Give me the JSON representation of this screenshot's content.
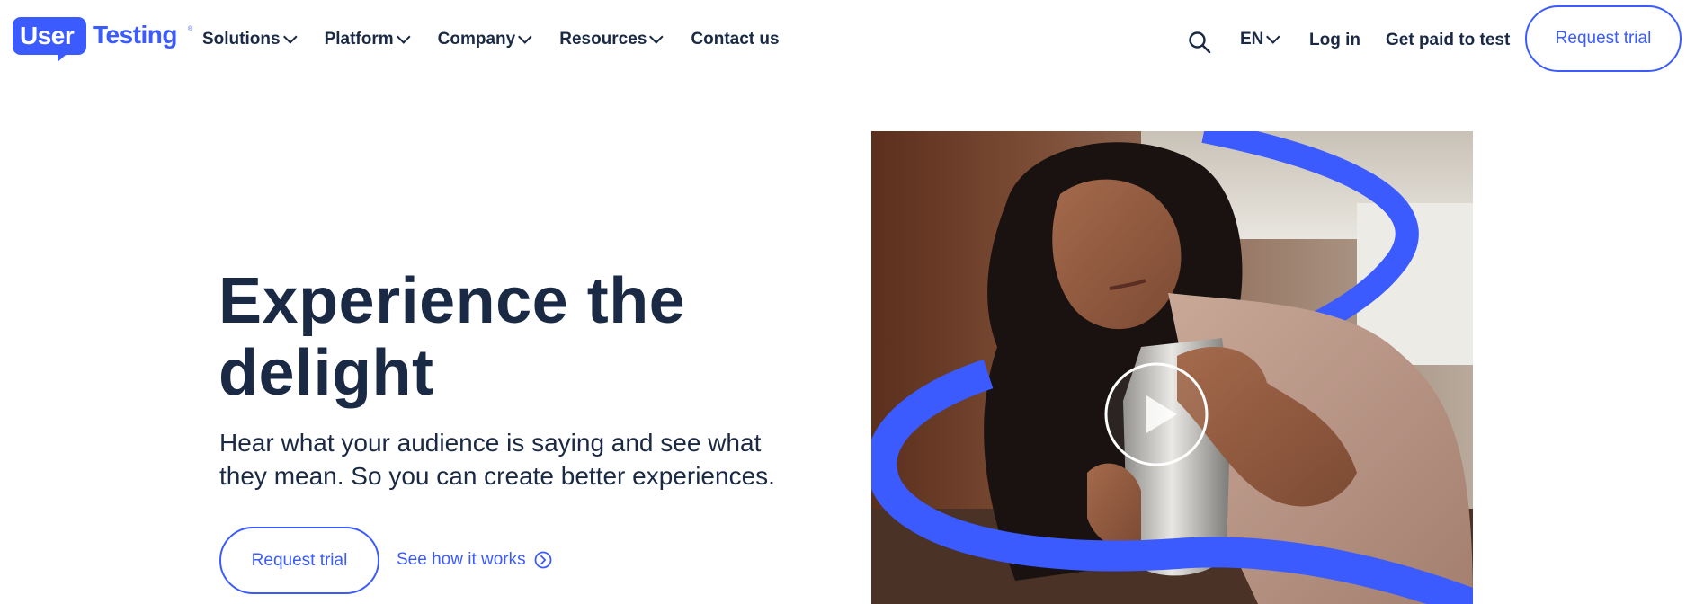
{
  "header": {
    "logo": {
      "part1": "User",
      "part2": "Testing",
      "tm": "®"
    },
    "nav": [
      {
        "label": "Solutions",
        "dropdown": true
      },
      {
        "label": "Platform",
        "dropdown": true
      },
      {
        "label": "Company",
        "dropdown": true
      },
      {
        "label": "Resources",
        "dropdown": true
      },
      {
        "label": "Contact us",
        "dropdown": false
      }
    ],
    "search_icon": "search-icon",
    "language": "EN",
    "login": "Log in",
    "get_paid": "Get paid to test",
    "request_trial": "Request trial"
  },
  "hero": {
    "title_line1": "Experience the",
    "title_line2": "delight",
    "subtitle_line1": "Hear what your audience is saying and see what",
    "subtitle_line2": "they mean. So you can create better experiences.",
    "cta_primary": "Request trial",
    "cta_secondary": "See how it works",
    "cta_secondary_icon": "chevron-right-circle-icon",
    "media_icon": "play-icon"
  },
  "colors": {
    "brand_blue": "#3b5bff",
    "text_dark": "#1b2a44",
    "background": "#ffffff"
  }
}
